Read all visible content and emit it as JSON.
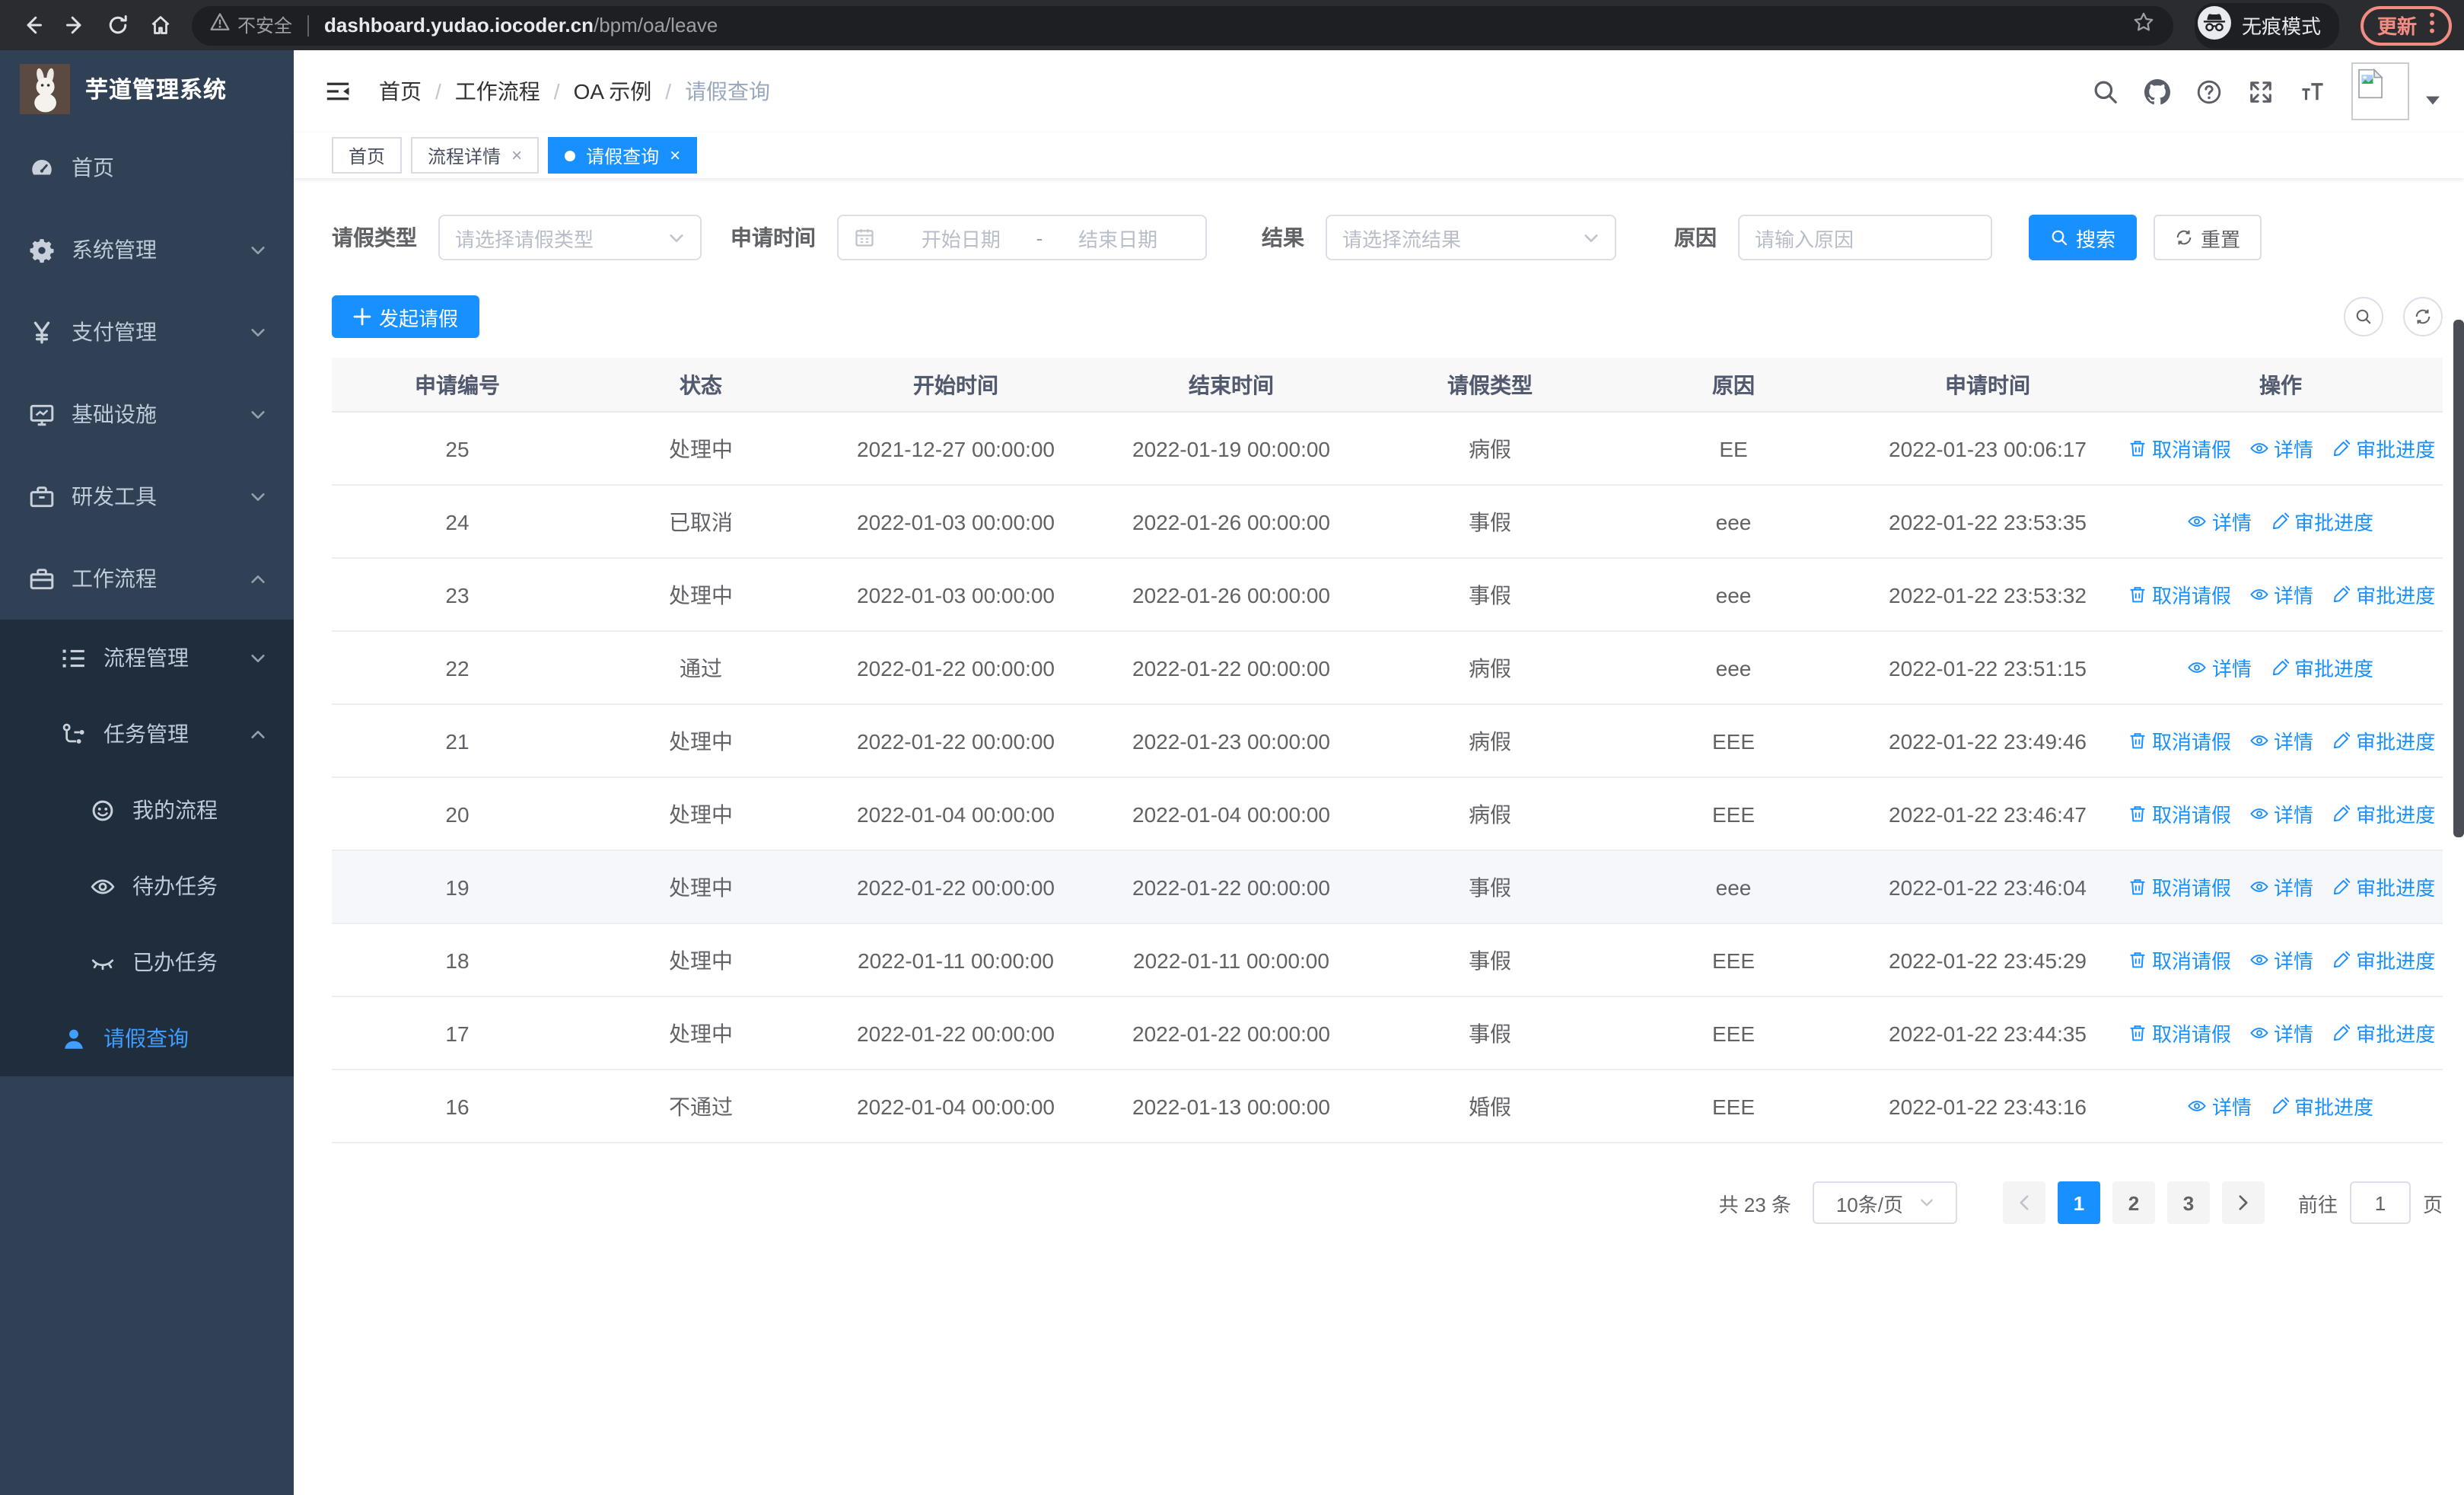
{
  "colors": {
    "accent": "#1890ff",
    "sidebar_bg": "#304156",
    "submenu_bg": "#1f2d3d",
    "sidebar_active": "#409eff",
    "update_badge": "#f28b82"
  },
  "browser": {
    "security_label": "不安全",
    "url_host": "dashboard.yudao.iocoder.cn",
    "url_path": "/bpm/oa/leave",
    "incognito_label": "无痕模式",
    "update_label": "更新"
  },
  "sidebar": {
    "title": "芋道管理系统",
    "items": [
      {
        "label": "首页",
        "icon": "gauge-icon",
        "level": 1,
        "sub": false,
        "chevron": "",
        "active": false
      },
      {
        "label": "系统管理",
        "icon": "gear-icon",
        "level": 1,
        "sub": false,
        "chevron": "down",
        "active": false
      },
      {
        "label": "支付管理",
        "icon": "yen-icon",
        "level": 1,
        "sub": false,
        "chevron": "down",
        "active": false
      },
      {
        "label": "基础设施",
        "icon": "monitor-icon",
        "level": 1,
        "sub": false,
        "chevron": "down",
        "active": false
      },
      {
        "label": "研发工具",
        "icon": "toolbox-icon",
        "level": 1,
        "sub": false,
        "chevron": "down",
        "active": false
      },
      {
        "label": "工作流程",
        "icon": "briefcase-icon",
        "level": 1,
        "sub": false,
        "chevron": "up",
        "active": false
      },
      {
        "label": "流程管理",
        "icon": "list-icon",
        "level": 2,
        "sub": true,
        "chevron": "down",
        "active": false
      },
      {
        "label": "任务管理",
        "icon": "flow-icon",
        "level": 2,
        "sub": true,
        "chevron": "up",
        "active": false
      },
      {
        "label": "我的流程",
        "icon": "face-icon",
        "level": 3,
        "sub": true,
        "chevron": "",
        "active": false
      },
      {
        "label": "待办任务",
        "icon": "eye-open-icon",
        "level": 3,
        "sub": true,
        "chevron": "",
        "active": false
      },
      {
        "label": "已办任务",
        "icon": "eye-closed-icon",
        "level": 3,
        "sub": true,
        "chevron": "",
        "active": false
      },
      {
        "label": "请假查询",
        "icon": "user-icon",
        "level": 2,
        "sub": true,
        "chevron": "",
        "active": true
      }
    ]
  },
  "breadcrumb": [
    "首页",
    "工作流程",
    "OA 示例",
    "请假查询"
  ],
  "tabs": [
    {
      "label": "首页",
      "closable": false,
      "active": false
    },
    {
      "label": "流程详情",
      "closable": true,
      "active": false
    },
    {
      "label": "请假查询",
      "closable": true,
      "active": true
    }
  ],
  "filters": {
    "leave_type": {
      "label": "请假类型",
      "placeholder": "请选择请假类型"
    },
    "apply_time": {
      "label": "申请时间",
      "start_placeholder": "开始日期",
      "separator": "-",
      "end_placeholder": "结束日期"
    },
    "result": {
      "label": "结果",
      "placeholder": "请选择流结果"
    },
    "reason": {
      "label": "原因",
      "placeholder": "请输入原因"
    },
    "search_label": "搜索",
    "reset_label": "重置"
  },
  "table": {
    "create_label": "发起请假",
    "columns": [
      "申请编号",
      "状态",
      "开始时间",
      "结束时间",
      "请假类型",
      "原因",
      "申请时间",
      "操作"
    ],
    "action_labels": {
      "cancel": "取消请假",
      "detail": "详情",
      "progress": "审批进度"
    },
    "rows": [
      {
        "id": "25",
        "status": "处理中",
        "start": "2021-12-27 00:00:00",
        "end": "2022-01-19 00:00:00",
        "type": "病假",
        "reason": "EE",
        "applied": "2022-01-23 00:06:17",
        "actions": [
          "cancel",
          "detail",
          "progress"
        ],
        "highlight": false
      },
      {
        "id": "24",
        "status": "已取消",
        "start": "2022-01-03 00:00:00",
        "end": "2022-01-26 00:00:00",
        "type": "事假",
        "reason": "eee",
        "applied": "2022-01-22 23:53:35",
        "actions": [
          "detail",
          "progress"
        ],
        "highlight": false
      },
      {
        "id": "23",
        "status": "处理中",
        "start": "2022-01-03 00:00:00",
        "end": "2022-01-26 00:00:00",
        "type": "事假",
        "reason": "eee",
        "applied": "2022-01-22 23:53:32",
        "actions": [
          "cancel",
          "detail",
          "progress"
        ],
        "highlight": false
      },
      {
        "id": "22",
        "status": "通过",
        "start": "2022-01-22 00:00:00",
        "end": "2022-01-22 00:00:00",
        "type": "病假",
        "reason": "eee",
        "applied": "2022-01-22 23:51:15",
        "actions": [
          "detail",
          "progress"
        ],
        "highlight": false
      },
      {
        "id": "21",
        "status": "处理中",
        "start": "2022-01-22 00:00:00",
        "end": "2022-01-23 00:00:00",
        "type": "病假",
        "reason": "EEE",
        "applied": "2022-01-22 23:49:46",
        "actions": [
          "cancel",
          "detail",
          "progress"
        ],
        "highlight": false
      },
      {
        "id": "20",
        "status": "处理中",
        "start": "2022-01-04 00:00:00",
        "end": "2022-01-04 00:00:00",
        "type": "病假",
        "reason": "EEE",
        "applied": "2022-01-22 23:46:47",
        "actions": [
          "cancel",
          "detail",
          "progress"
        ],
        "highlight": false
      },
      {
        "id": "19",
        "status": "处理中",
        "start": "2022-01-22 00:00:00",
        "end": "2022-01-22 00:00:00",
        "type": "事假",
        "reason": "eee",
        "applied": "2022-01-22 23:46:04",
        "actions": [
          "cancel",
          "detail",
          "progress"
        ],
        "highlight": true
      },
      {
        "id": "18",
        "status": "处理中",
        "start": "2022-01-11 00:00:00",
        "end": "2022-01-11 00:00:00",
        "type": "事假",
        "reason": "EEE",
        "applied": "2022-01-22 23:45:29",
        "actions": [
          "cancel",
          "detail",
          "progress"
        ],
        "highlight": false
      },
      {
        "id": "17",
        "status": "处理中",
        "start": "2022-01-22 00:00:00",
        "end": "2022-01-22 00:00:00",
        "type": "事假",
        "reason": "EEE",
        "applied": "2022-01-22 23:44:35",
        "actions": [
          "cancel",
          "detail",
          "progress"
        ],
        "highlight": false
      },
      {
        "id": "16",
        "status": "不通过",
        "start": "2022-01-04 00:00:00",
        "end": "2022-01-13 00:00:00",
        "type": "婚假",
        "reason": "EEE",
        "applied": "2022-01-22 23:43:16",
        "actions": [
          "detail",
          "progress"
        ],
        "highlight": false
      }
    ]
  },
  "pagination": {
    "total_text": "共 23 条",
    "page_size": "10条/页",
    "pages": [
      "1",
      "2",
      "3"
    ],
    "active_page": "1",
    "goto_label": "前往",
    "goto_value": "1",
    "goto_suffix": "页"
  }
}
